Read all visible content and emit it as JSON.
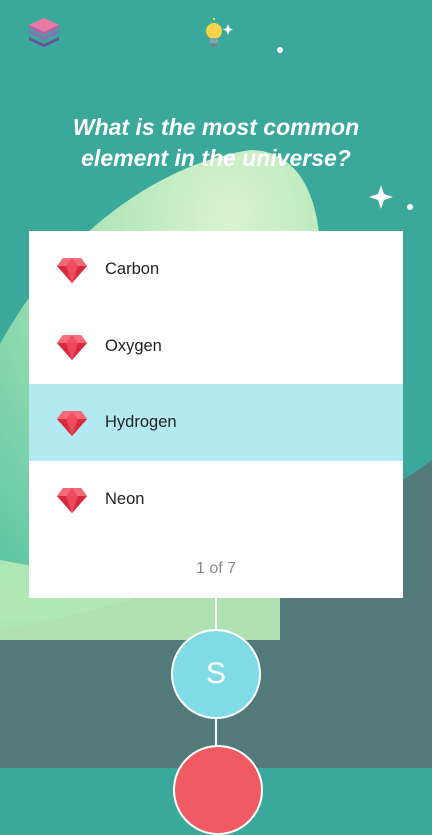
{
  "header": {
    "left_icon": "layers-icon",
    "center_icon": "lightbulb-sparkle-icon"
  },
  "question": {
    "text": "What is the most common element in the universe?"
  },
  "options": [
    {
      "label": "Carbon",
      "icon": "ruby-gem-icon",
      "selected": false
    },
    {
      "label": "Oxygen",
      "icon": "ruby-gem-icon",
      "selected": false
    },
    {
      "label": "Hydrogen",
      "icon": "ruby-gem-icon",
      "selected": true
    },
    {
      "label": "Neon",
      "icon": "ruby-gem-icon",
      "selected": false
    }
  ],
  "progress": {
    "counter_text": "1 of 7"
  },
  "path_nodes": [
    {
      "label": "S",
      "color": "#7fdbe6"
    },
    {
      "label": "",
      "color": "#f05a63"
    }
  ],
  "colors": {
    "background": "#3aa89b",
    "selected_option": "#b3eaf1",
    "gem": "#e8334a"
  }
}
